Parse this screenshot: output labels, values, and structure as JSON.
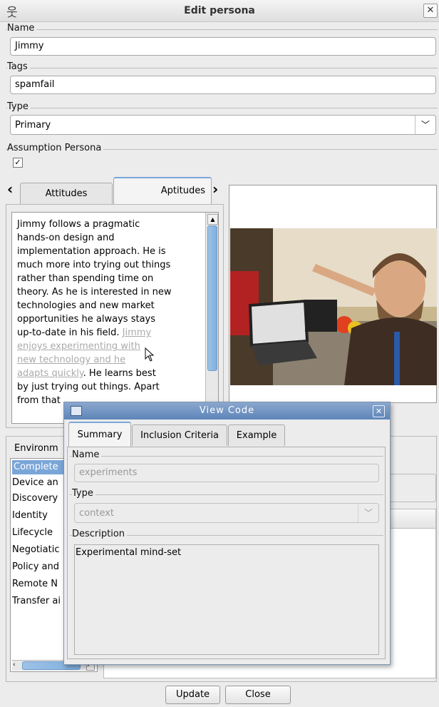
{
  "window": {
    "title": "Edit persona"
  },
  "fields": {
    "name_label": "Name",
    "name_value": "Jimmy",
    "tags_label": "Tags",
    "tags_value": "spamfail",
    "type_label": "Type",
    "type_value": "Primary",
    "assumption_label": "Assumption Persona",
    "assumption_checked": "✓"
  },
  "tabs": [
    {
      "label": "Attitudes"
    },
    {
      "label": "Aptitudes"
    }
  ],
  "description": {
    "lines": [
      "Jimmy follows a pragmatic",
      "hands-on design and",
      "implementation approach. He is",
      "much more into trying out things",
      "rather than spending time on",
      "theory. As he is interested in new",
      "technologies and new market",
      "opportunities he always stays"
    ],
    "line9_prefix": "up-to-date in his field. ",
    "line9_link": "Jimmy",
    "link_line2": "enjoys experimenting with",
    "link_line3": "new technology and he",
    "link_line4_link": "adapts quickly",
    "link_line4_suffix": ". He learns best",
    "line11": "by just trying out things. Apart",
    "line12": "from that"
  },
  "environment": {
    "tab_label": "Environm",
    "items": [
      "Complete",
      "Device an",
      "Discovery",
      "Identity",
      "Lifecycle",
      "Negotiatic",
      "Policy and",
      "Remote N",
      "Transfer ai"
    ]
  },
  "buttons": {
    "update": "Update",
    "close": "Close"
  },
  "dialog": {
    "title": "View Code",
    "tabs": [
      "Summary",
      "Inclusion Criteria",
      "Example"
    ],
    "name_label": "Name",
    "name_value": "experiments",
    "type_label": "Type",
    "type_value": "context",
    "description_label": "Description",
    "description_value": "Experimental mind-set"
  },
  "colors": {
    "selection": "#7aa5d8",
    "dialog_title": "#6b8fc2",
    "link_ghost": "#aaaaaa"
  }
}
